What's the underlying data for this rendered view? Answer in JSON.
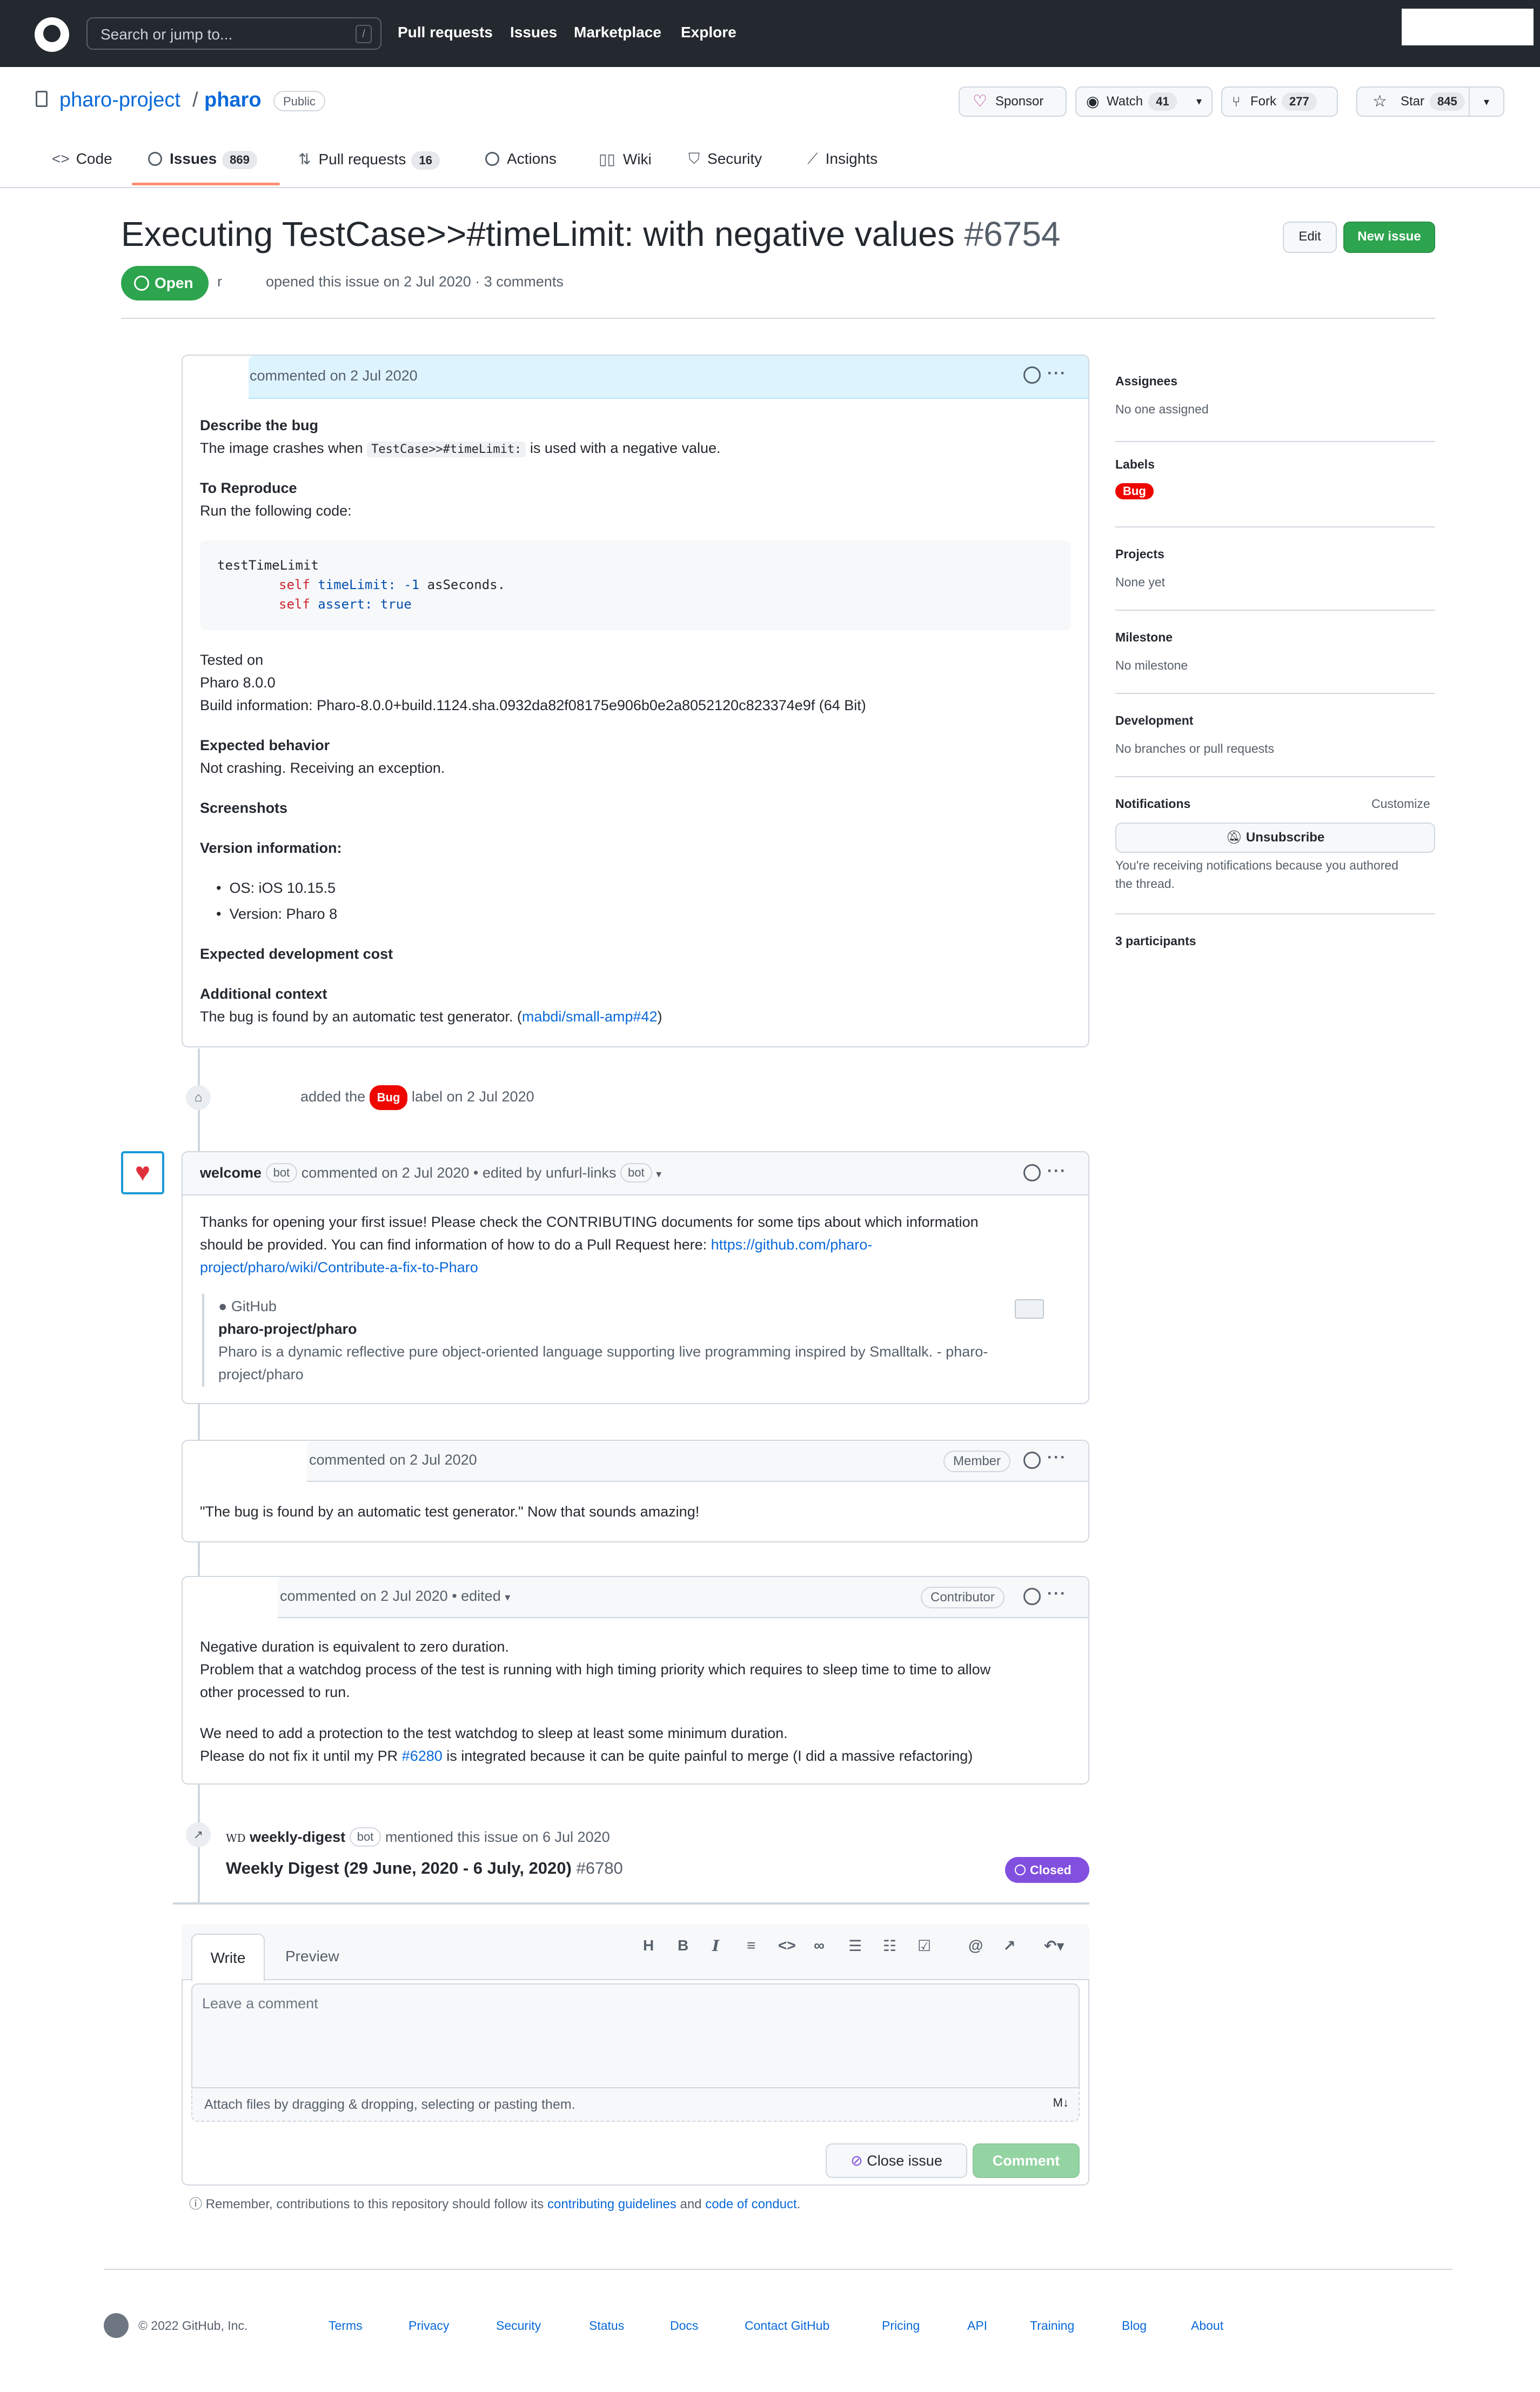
{
  "header": {
    "search_placeholder": "Search or jump to...",
    "search_key": "/",
    "nav": [
      "Pull requests",
      "Issues",
      "Marketplace",
      "Explore"
    ]
  },
  "repo": {
    "owner": "pharo-project",
    "name": "pharo",
    "visibility": "Public",
    "sponsor_label": "Sponsor",
    "watch_label": "Watch",
    "watch_count": "41",
    "fork_label": "Fork",
    "fork_count": "277",
    "star_label": "Star",
    "star_count": "845"
  },
  "tabs": [
    {
      "label": "Code"
    },
    {
      "label": "Issues",
      "count": "869"
    },
    {
      "label": "Pull requests",
      "count": "16"
    },
    {
      "label": "Actions"
    },
    {
      "label": "Wiki"
    },
    {
      "label": "Security"
    },
    {
      "label": "Insights"
    }
  ],
  "issue": {
    "title": "Executing TestCase>>#timeLimit: with negative values",
    "number": "#6754",
    "edit_label": "Edit",
    "new_issue_label": "New issue",
    "state": "Open",
    "author_initial": "r",
    "meta": "opened this issue on 2 Jul 2020 · 3 comments"
  },
  "first_comment": {
    "header": "commented on 2 Jul 2020",
    "describe_heading": "Describe the bug",
    "describe_prefix": "The image crashes when ",
    "describe_code": "TestCase>>#timeLimit:",
    "describe_suffix": " is used with a negative value.",
    "reproduce_heading": "To Reproduce",
    "reproduce_text": "Run the following code:",
    "code": {
      "line1": "testTimeLimit",
      "line2_self": "self",
      "line2_sel": "timeLimit:",
      "line2_num": "-1",
      "line2_rest": "asSeconds.",
      "line3_self": "self",
      "line3_sel": "assert:",
      "line3_val": "true"
    },
    "tested_on": "Tested on",
    "pharo_version": "Pharo 8.0.0",
    "build_info": "Build information: Pharo-8.0.0+build.1124.sha.0932da82f08175e906b0e2a8052120c823374e9f (64 Bit)",
    "expected_heading": "Expected behavior",
    "expected_text": "Not crashing. Receiving an exception.",
    "screenshots_heading": "Screenshots",
    "version_heading": "Version information:",
    "version_items": [
      "OS: iOS 10.15.5",
      "Version: Pharo 8"
    ],
    "cost_heading": "Expected development cost",
    "context_heading": "Additional context",
    "context_prefix": "The bug is found by an automatic test generator. (",
    "context_link": "mabdi/small-amp#42",
    "context_suffix": ")"
  },
  "label_event": {
    "prefix": "added the",
    "label": "Bug",
    "suffix": "label on 2 Jul 2020"
  },
  "welcome_comment": {
    "author": "welcome",
    "bot": "bot",
    "meta": "commented on 2 Jul 2020 • edited by unfurl-links",
    "bot2": "bot",
    "line1": "Thanks for opening your first issue! Please check the CONTRIBUTING documents for some tips about which information",
    "line2_prefix": "should be provided. You can find information of how to do a Pull Request here: ",
    "line2_link": "https://github.com/pharo-",
    "line3_link": "project/pharo/wiki/Contribute-a-fix-to-Pharo",
    "preview_site": "GitHub",
    "preview_title": "pharo-project/pharo",
    "preview_desc1": "Pharo is a dynamic reflective pure object-oriented language supporting live programming inspired by Smalltalk. - pharo-",
    "preview_desc2": "project/pharo"
  },
  "member_comment": {
    "header": "commented on 2 Jul 2020",
    "role": "Member",
    "text": "\"The bug is found by an automatic test generator.\" Now that sounds amazing!"
  },
  "contributor_comment": {
    "header": "commented on 2 Jul 2020 • edited",
    "role": "Contributor",
    "line1": "Negative duration is equivalent to zero duration.",
    "line2": "Problem that a watchdog process of the test is running with high timing priority which requires to sleep time to time to allow",
    "line3": "other processed to run.",
    "line4": "We need to add a protection to the test watchdog to sleep at least some minimum duration.",
    "line5_prefix": "Please do not fix it until my PR ",
    "line5_link": "#6280",
    "line5_suffix": " is integrated because it can be quite painful to merge (I did a massive refactoring)"
  },
  "mention_event": {
    "avatar_text": "WD",
    "author": "weekly-digest",
    "bot": "bot",
    "text": "mentioned this issue on 6 Jul 2020",
    "ref_title": "Weekly Digest (29 June, 2020 - 6 July, 2020)",
    "ref_number": "#6780",
    "ref_state": "Closed"
  },
  "editor": {
    "write_tab": "Write",
    "preview_tab": "Preview",
    "placeholder": "Leave a comment",
    "attach_text": "Attach files by dragging & dropping, selecting or pasting them.",
    "close_label": "Close issue",
    "comment_label": "Comment",
    "remember_prefix": "Remember, contributions to this repository should follow its ",
    "remember_link1": "contributing guidelines",
    "remember_mid": " and ",
    "remember_link2": "code of conduct",
    "remember_suffix": "."
  },
  "sidebar": {
    "assignees_title": "Assignees",
    "assignees_value": "No one assigned",
    "labels_title": "Labels",
    "labels_value": "Bug",
    "projects_title": "Projects",
    "projects_value": "None yet",
    "milestone_title": "Milestone",
    "milestone_value": "No milestone",
    "development_title": "Development",
    "development_value": "No branches or pull requests",
    "notifications_title": "Notifications",
    "customize_label": "Customize",
    "unsubscribe_label": "Unsubscribe",
    "notify_line1": "You're receiving notifications because you authored",
    "notify_line2": "the thread.",
    "participants": "3 participants"
  },
  "footer": {
    "copyright": "© 2022 GitHub, Inc.",
    "links": [
      "Terms",
      "Privacy",
      "Security",
      "Status",
      "Docs",
      "Contact GitHub",
      "Pricing",
      "API",
      "Training",
      "Blog",
      "About"
    ]
  },
  "colors": {
    "header_bg": "#24292f",
    "accent_green": "#2da44e",
    "link_blue": "#0969da",
    "bug_red": "#ee0701",
    "closed_purple": "#8250df"
  }
}
